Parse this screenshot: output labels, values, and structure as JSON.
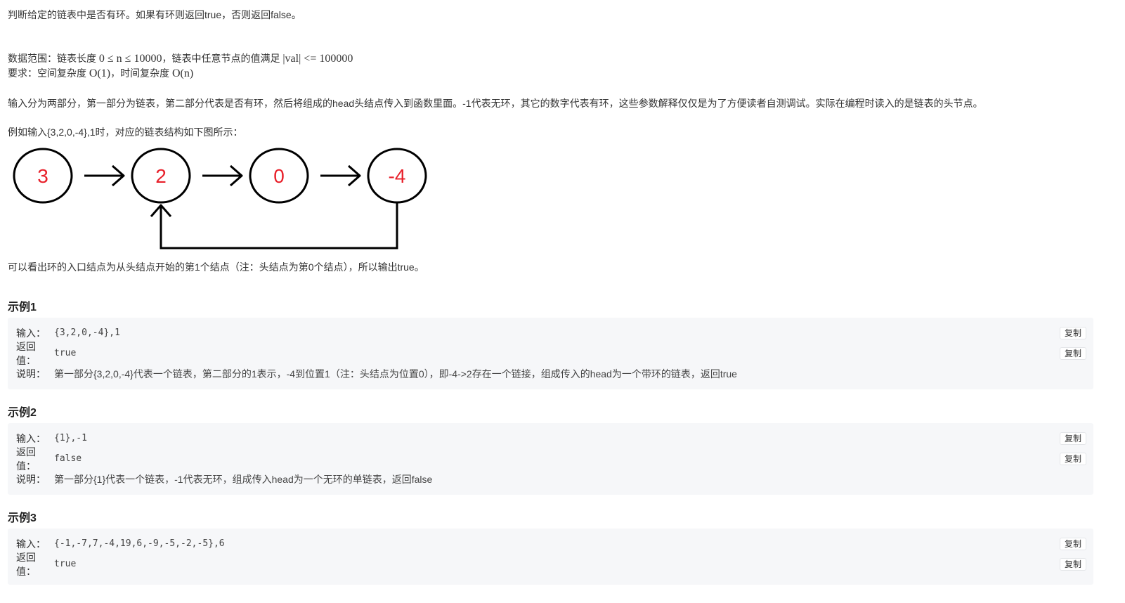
{
  "intro": "判断给定的链表中是否有环。如果有环则返回true，否则返回false。",
  "range": {
    "prefix": "数据范围：链表长度 ",
    "math1": "0 ≤ n ≤ 10000",
    "middle": "，链表中任意节点的值满足 ",
    "math2": "|val| <= 100000"
  },
  "requirement": {
    "prefix": "要求：空间复杂度 ",
    "math1": "O(1)",
    "middle": "，时间复杂度 ",
    "math2": "O(n)"
  },
  "input_desc": "输入分为两部分，第一部分为链表，第二部分代表是否有环，然后将组成的head头结点传入到函数里面。-1代表无环，其它的数字代表有环，这些参数解释仅仅是为了方便读者自测调试。实际在编程时读入的是链表的头节点。",
  "example_intro": "例如输入{3,2,0,-4},1时，对应的链表结构如下图所示：",
  "diagram": {
    "nodes": [
      "3",
      "2",
      "0",
      "-4"
    ],
    "cycle_from": 3,
    "cycle_to": 1
  },
  "explanation": "可以看出环的入口结点为从头结点开始的第1个结点（注：头结点为第0个结点），所以输出true。",
  "examples": [
    {
      "title": "示例1",
      "input_label": "输入：",
      "input": "{3,2,0,-4},1",
      "return_label": "返回值：",
      "return": "true",
      "note_label": "说明：",
      "note": "第一部分{3,2,0,-4}代表一个链表，第二部分的1表示，-4到位置1（注：头结点为位置0），即-4->2存在一个链接，组成传入的head为一个带环的链表，返回true",
      "copy": "复制"
    },
    {
      "title": "示例2",
      "input_label": "输入：",
      "input": "{1},-1",
      "return_label": "返回值：",
      "return": "false",
      "note_label": "说明：",
      "note": "第一部分{1}代表一个链表，-1代表无环，组成传入head为一个无环的单链表，返回false",
      "copy": "复制"
    },
    {
      "title": "示例3",
      "input_label": "输入：",
      "input": "{-1,-7,7,-4,19,6,-9,-5,-2,-5},6",
      "return_label": "返回值：",
      "return": "true",
      "copy": "复制"
    }
  ]
}
